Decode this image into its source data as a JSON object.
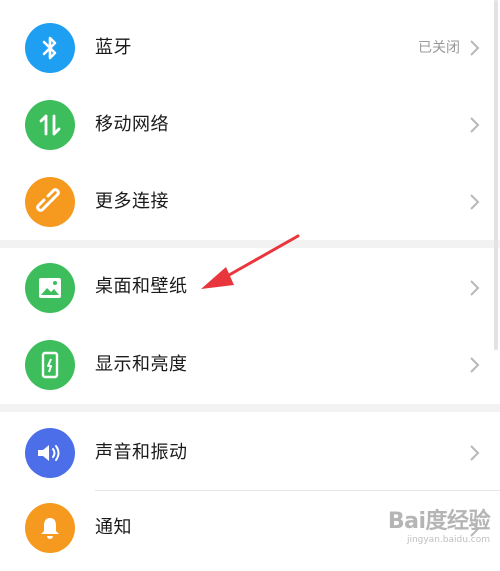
{
  "settings": {
    "items": [
      {
        "label": "蓝牙",
        "status": "已关闭",
        "icon": "bluetooth-icon",
        "color": "#1e9ff2"
      },
      {
        "label": "移动网络",
        "status": "",
        "icon": "mobile-data-icon",
        "color": "#3dbd5c"
      },
      {
        "label": "更多连接",
        "status": "",
        "icon": "link-icon",
        "color": "#f59a1f"
      },
      {
        "label": "桌面和壁纸",
        "status": "",
        "icon": "wallpaper-icon",
        "color": "#3dbd5c"
      },
      {
        "label": "显示和亮度",
        "status": "",
        "icon": "display-icon",
        "color": "#3dbd5c"
      },
      {
        "label": "声音和振动",
        "status": "",
        "icon": "sound-icon",
        "color": "#4c6ee8"
      },
      {
        "label": "通知",
        "status": "",
        "icon": "bell-icon",
        "color": "#f59a1f"
      }
    ]
  },
  "watermark": {
    "logo": "Bai度经验",
    "url": "jingyan.baidu.com"
  },
  "colors": {
    "annotation_arrow": "#e8363c",
    "section_gap": "#f2f2f2"
  }
}
